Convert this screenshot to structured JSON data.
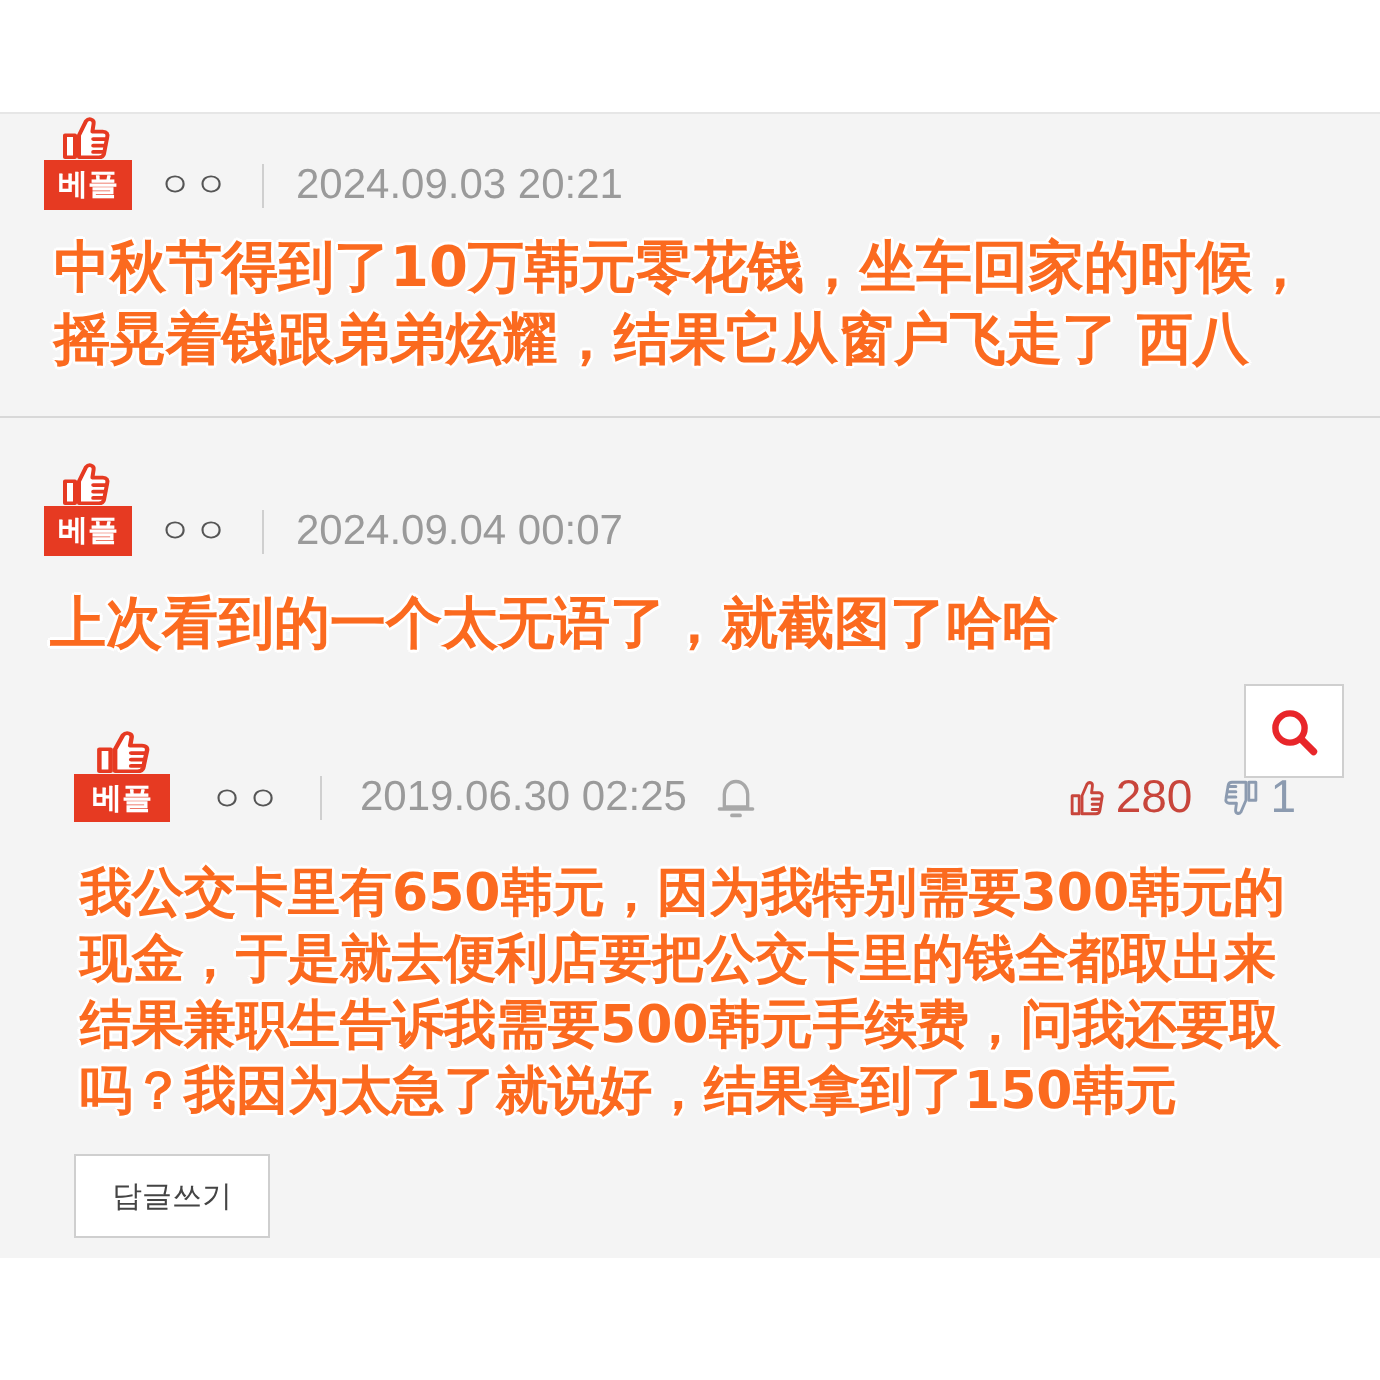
{
  "comments": [
    {
      "badge": "베플",
      "author": "ㅇㅇ",
      "date": "2024.09.03 20:21",
      "caption_lines": [
        "中秋节得到了10万韩元零花钱，坐车回家的时候，",
        "摇晃着钱跟弟弟炫耀，结果它从窗户飞走了 西八"
      ]
    },
    {
      "badge": "베플",
      "author": "ㅇㅇ",
      "date": "2024.09.04 00:07",
      "caption_lines": [
        "上次看到的一个太无语了，就截图了哈哈"
      ],
      "screenshot": {
        "badge": "베플",
        "author": "ㅇㅇ",
        "date": "2019.06.30 02:25",
        "likes": "280",
        "dislikes": "1",
        "caption_lines": [
          "我公交卡里有650韩元，因为我特别需要300韩元的",
          "现金，于是就去便利店要把公交卡里的钱全都取出来",
          "结果兼职生告诉我需要500韩元手续费，问我还要取",
          "吗？我因为太急了就说好，结果拿到了150韩元"
        ],
        "reply_button": "답글쓰기"
      }
    }
  ]
}
